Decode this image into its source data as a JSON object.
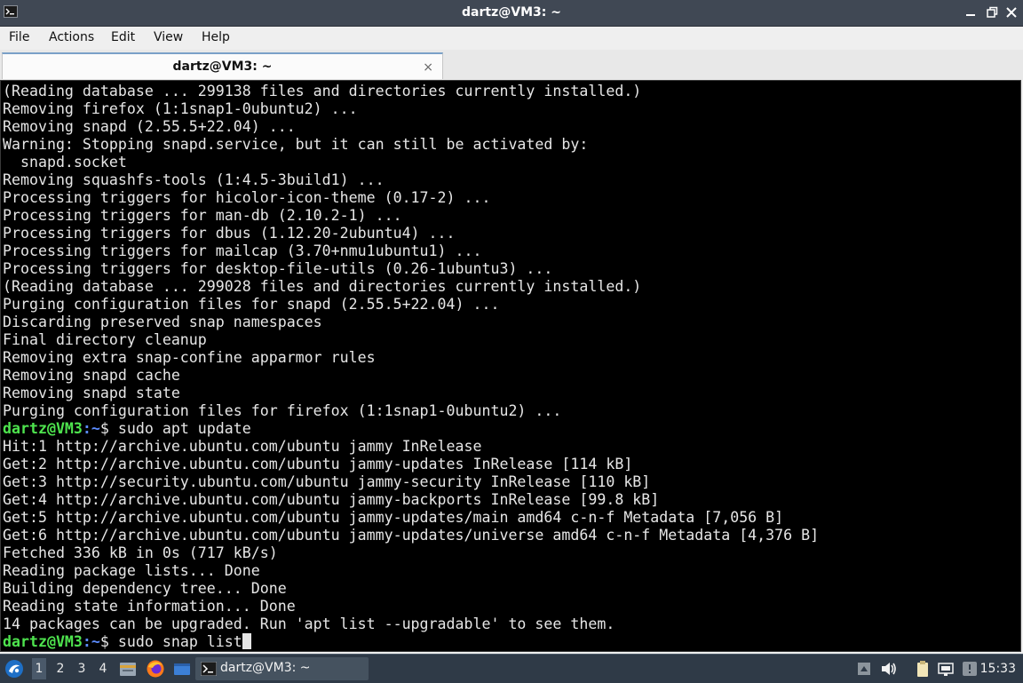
{
  "window": {
    "title": "dartz@VM3: ~"
  },
  "menu": {
    "file": "File",
    "actions": "Actions",
    "edit": "Edit",
    "view": "View",
    "help": "Help"
  },
  "tab": {
    "label": "dartz@VM3: ~",
    "close": "×"
  },
  "terminal": {
    "lines": [
      "(Reading database ... 299138 files and directories currently installed.)",
      "Removing firefox (1:1snap1-0ubuntu2) ...",
      "Removing snapd (2.55.5+22.04) ...",
      "Warning: Stopping snapd.service, but it can still be activated by:",
      "  snapd.socket",
      "Removing squashfs-tools (1:4.5-3build1) ...",
      "Processing triggers for hicolor-icon-theme (0.17-2) ...",
      "Processing triggers for man-db (2.10.2-1) ...",
      "Processing triggers for dbus (1.12.20-2ubuntu4) ...",
      "Processing triggers for mailcap (3.70+nmu1ubuntu1) ...",
      "Processing triggers for desktop-file-utils (0.26-1ubuntu3) ...",
      "(Reading database ... 299028 files and directories currently installed.)",
      "Purging configuration files for snapd (2.55.5+22.04) ...",
      "Discarding preserved snap namespaces",
      "Final directory cleanup",
      "Removing extra snap-confine apparmor rules",
      "Removing snapd cache",
      "Removing snapd state",
      "Purging configuration files for firefox (1:1snap1-0ubuntu2) ..."
    ],
    "prompt1": {
      "user": "dartz@VM3",
      "path": ":~",
      "symbol": "$ ",
      "command": "sudo apt update"
    },
    "lines2": [
      "Hit:1 http://archive.ubuntu.com/ubuntu jammy InRelease",
      "Get:2 http://archive.ubuntu.com/ubuntu jammy-updates InRelease [114 kB]",
      "Get:3 http://security.ubuntu.com/ubuntu jammy-security InRelease [110 kB]",
      "Get:4 http://archive.ubuntu.com/ubuntu jammy-backports InRelease [99.8 kB]",
      "Get:5 http://archive.ubuntu.com/ubuntu jammy-updates/main amd64 c-n-f Metadata [7,056 B]",
      "Get:6 http://archive.ubuntu.com/ubuntu jammy-updates/universe amd64 c-n-f Metadata [4,376 B]",
      "Fetched 336 kB in 0s (717 kB/s)",
      "Reading package lists... Done",
      "Building dependency tree... Done",
      "Reading state information... Done",
      "14 packages can be upgraded. Run 'apt list --upgradable' to see them."
    ],
    "prompt2": {
      "user": "dartz@VM3",
      "path": ":~",
      "symbol": "$ ",
      "command": "sudo snap list"
    }
  },
  "taskbar": {
    "workspaces": [
      "1",
      "2",
      "3",
      "4"
    ],
    "task_label": "dartz@VM3: ~",
    "clock": "15:33"
  },
  "icons": {
    "start": "lubuntu-start-icon",
    "files": "file-manager-icon",
    "browser": "firefox-icon",
    "desktop": "show-desktop-icon",
    "terminal": "terminal-icon",
    "tray": [
      "tray-arrow-icon",
      "volume-icon",
      "clipboard-icon",
      "network-icon",
      "notification-icon"
    ]
  },
  "colors": {
    "terminal_bg": "#000000",
    "terminal_fg": "#e6e6e6",
    "prompt_user": "#4ee44e",
    "prompt_path": "#5c8cff",
    "titlebar_bg": "#404854",
    "taskbar_bg": "#2f3a47"
  }
}
